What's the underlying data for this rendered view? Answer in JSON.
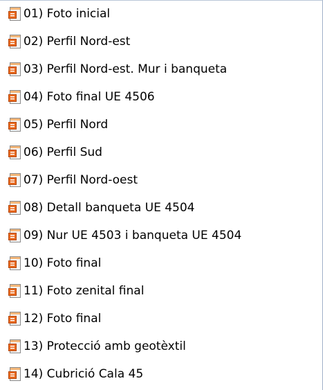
{
  "file_list": {
    "icon": "presentation-document-icon",
    "items": [
      {
        "label": "01) Foto inicial"
      },
      {
        "label": "02) Perfil Nord-est"
      },
      {
        "label": "03) Perfil Nord-est. Mur i banqueta"
      },
      {
        "label": "04) Foto final UE 4506"
      },
      {
        "label": "05) Perfil Nord"
      },
      {
        "label": "06) Perfil Sud"
      },
      {
        "label": "07) Perfil Nord-oest"
      },
      {
        "label": "08) Detall banqueta UE 4504"
      },
      {
        "label": "09) Nur UE 4503 i banqueta UE 4504"
      },
      {
        "label": "10) Foto final"
      },
      {
        "label": "11) Foto zenital final"
      },
      {
        "label": "12) Foto final"
      },
      {
        "label": "13) Protecció amb geotèxtil"
      },
      {
        "label": "14) Cubrició Cala 45"
      }
    ]
  },
  "colors": {
    "icon_sheet": "#f4f4f4",
    "icon_accent": "#e8681c",
    "icon_border": "#8a8a8a",
    "icon_band": "#f3b77a"
  }
}
